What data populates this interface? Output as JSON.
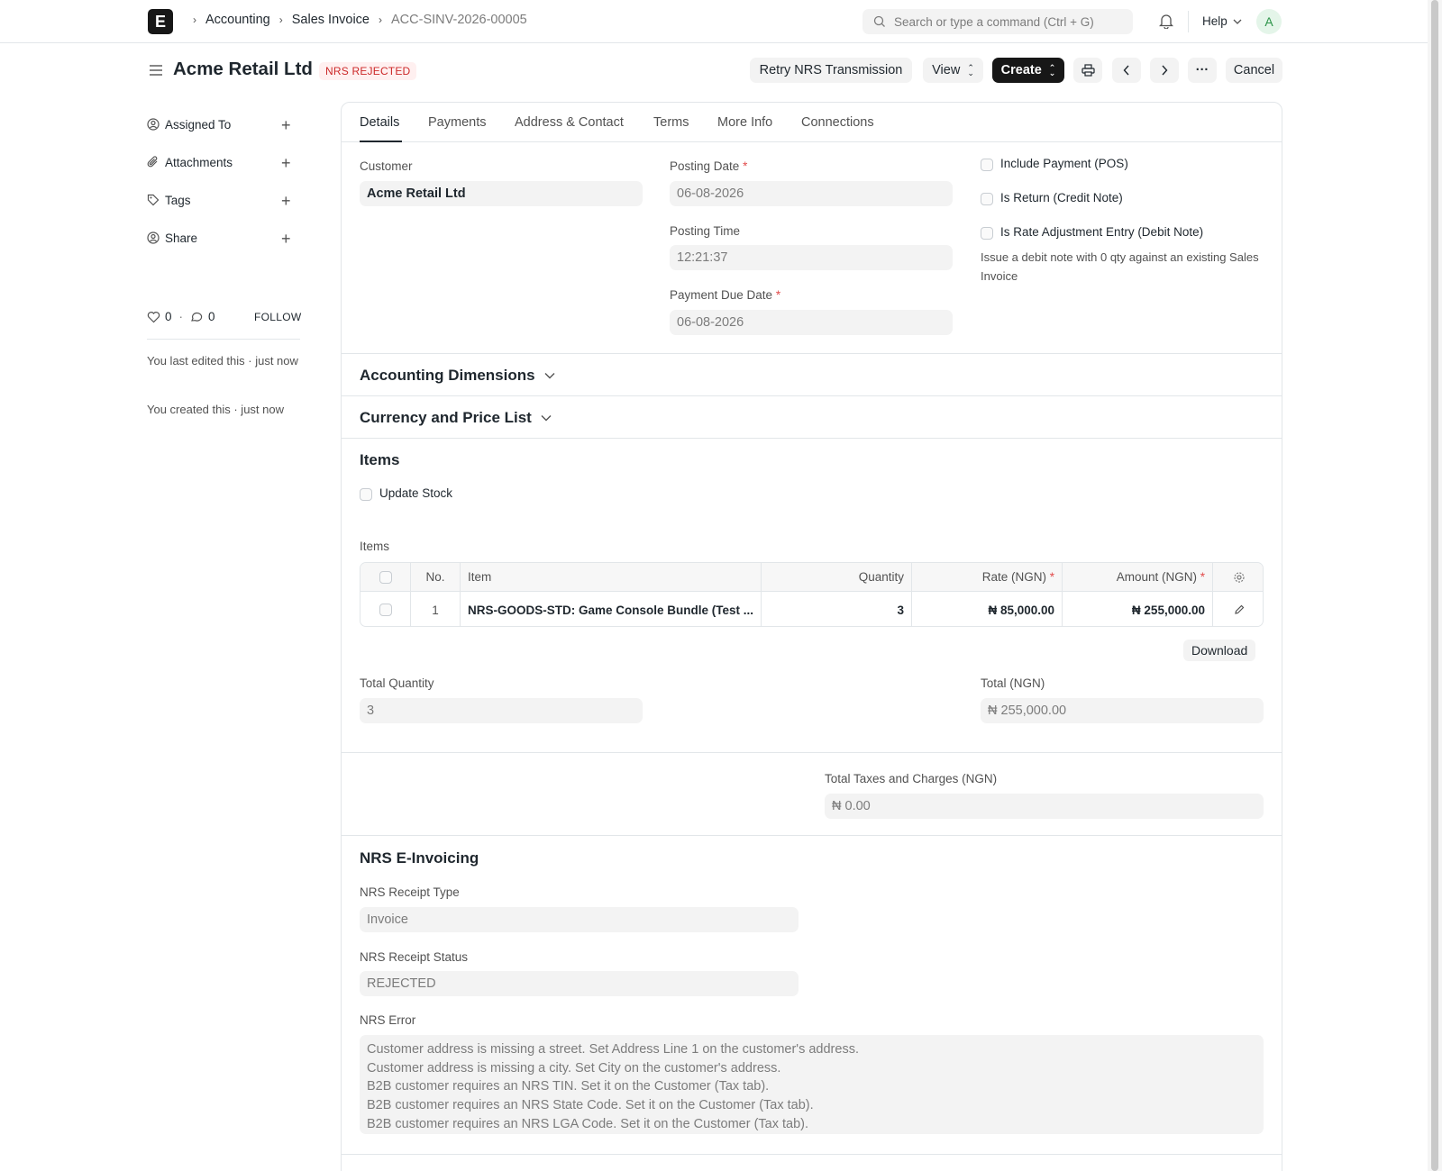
{
  "navbar": {
    "logo": "E",
    "breadcrumbs": [
      "Accounting",
      "Sales Invoice",
      "ACC-SINV-2026-00005"
    ],
    "search_placeholder": "Search or type a command (Ctrl + G)",
    "help_label": "Help",
    "avatar_initial": "A"
  },
  "header": {
    "title": "Acme Retail Ltd",
    "status_badge": "NRS REJECTED",
    "buttons": {
      "retry": "Retry NRS Transmission",
      "view": "View",
      "create": "Create",
      "cancel": "Cancel",
      "more": "···"
    }
  },
  "sidebar": {
    "items": [
      {
        "label": "Assigned To",
        "icon": "assign-icon"
      },
      {
        "label": "Attachments",
        "icon": "paperclip-icon"
      },
      {
        "label": "Tags",
        "icon": "tag-icon"
      },
      {
        "label": "Share",
        "icon": "share-icon"
      }
    ],
    "likes": "0",
    "comments": "0",
    "follow": "FOLLOW",
    "activity": [
      "You last edited this · just now",
      "You created this · just now"
    ]
  },
  "tabs": [
    "Details",
    "Payments",
    "Address & Contact",
    "Terms",
    "More Info",
    "Connections"
  ],
  "details": {
    "customer_label": "Customer",
    "customer_value": "Acme Retail Ltd",
    "posting_date_label": "Posting Date",
    "posting_date_value": "06-08-2026",
    "posting_time_label": "Posting Time",
    "posting_time_value": "12:21:37",
    "payment_due_label": "Payment Due Date",
    "payment_due_value": "06-08-2026",
    "include_payment": "Include Payment (POS)",
    "is_return": "Is Return (Credit Note)",
    "is_rate_adjustment": "Is Rate Adjustment Entry (Debit Note)",
    "rate_adjustment_desc": "Issue a debit note with 0 qty against an existing Sales Invoice"
  },
  "sections": {
    "accounting_dimensions": "Accounting Dimensions",
    "currency_price_list": "Currency and Price List",
    "items": "Items",
    "nrs": "NRS E-Invoicing"
  },
  "items": {
    "update_stock": "Update Stock",
    "table_label": "Items",
    "columns": [
      "No.",
      "Item",
      "Quantity",
      "Rate (NGN)",
      "Amount (NGN)"
    ],
    "rows": [
      {
        "no": "1",
        "item": "NRS-GOODS-STD: Game Console Bundle (Test ...",
        "qty": "3",
        "rate": "₦ 85,000.00",
        "amount": "₦ 255,000.00"
      }
    ],
    "download": "Download",
    "total_qty_label": "Total Quantity",
    "total_qty_value": "3",
    "total_label": "Total (NGN)",
    "total_value": "₦ 255,000.00",
    "taxes_label": "Total Taxes and Charges (NGN)",
    "taxes_value": "₦ 0.00"
  },
  "nrs": {
    "receipt_type_label": "NRS Receipt Type",
    "receipt_type_value": "Invoice",
    "receipt_status_label": "NRS Receipt Status",
    "receipt_status_value": "REJECTED",
    "error_label": "NRS Error",
    "error_lines": [
      "Customer address is missing a street. Set Address Line 1 on the customer's address.",
      "Customer address is missing a city. Set City on the customer's address.",
      "B2B customer requires an NRS TIN. Set it on the Customer (Tax tab).",
      "B2B customer requires an NRS State Code. Set it on the Customer (Tax tab).",
      "B2B customer requires an NRS LGA Code. Set it on the Customer (Tax tab)."
    ]
  },
  "colors": {
    "accent": "#171717",
    "badge_bg": "#fff0f0",
    "badge_text": "#cc2929",
    "field_bg": "#f3f3f3"
  }
}
